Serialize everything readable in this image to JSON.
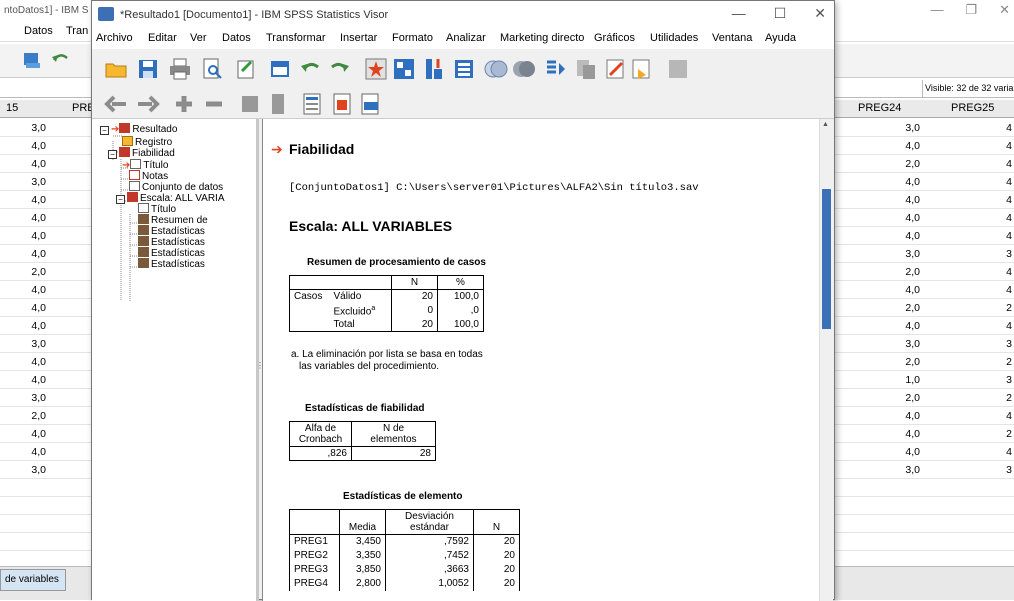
{
  "background_window": {
    "title": "ntoDatos1] - IBM S",
    "menu": [
      "Datos",
      "Tran"
    ],
    "visible_label": "Visible: 32 de 32 variable",
    "col_left_head": "15",
    "col_pre_head": "PRE",
    "col_preg24": "PREG24",
    "col_preg25": "PREG25",
    "left_values": [
      "3,0",
      "4,0",
      "4,0",
      "3,0",
      "4,0",
      "4,0",
      "4,0",
      "4,0",
      "2,0",
      "4,0",
      "4,0",
      "4,0",
      "3,0",
      "4,0",
      "4,0",
      "3,0",
      "2,0",
      "4,0",
      "4,0",
      "3,0"
    ],
    "preg24_values": [
      "3,0",
      "4,0",
      "2,0",
      "4,0",
      "4,0",
      "4,0",
      "4,0",
      "3,0",
      "2,0",
      "4,0",
      "2,0",
      "4,0",
      "3,0",
      "2,0",
      "1,0",
      "2,0",
      "4,0",
      "4,0",
      "4,0",
      "3,0"
    ],
    "preg25_values": [
      "4",
      "4",
      "4",
      "4",
      "4",
      "4",
      "4",
      "3",
      "4",
      "4",
      "2",
      "4",
      "3",
      "2",
      "3",
      "2",
      "4",
      "2",
      "4",
      "3"
    ],
    "tab_variable_view": "de variables"
  },
  "viewer": {
    "title": "*Resultado1 [Documento1] - IBM SPSS Statistics Visor",
    "menu": [
      "Archivo",
      "Editar",
      "Ver",
      "Datos",
      "Transformar",
      "Insertar",
      "Formato",
      "Analizar",
      "Marketing directo",
      "Gráficos",
      "Utilidades",
      "Ventana",
      "Ayuda"
    ],
    "outline": {
      "resultado": "Resultado",
      "registro": "Registro",
      "fiabilidad": "Fiabilidad",
      "titulo": "Título",
      "notas": "Notas",
      "conjunto": "Conjunto de datos",
      "escala": "Escala: ALL VARIA",
      "titulo2": "Título",
      "resumen": "Resumen de",
      "est1": "Estadísticas",
      "est2": "Estadísticas",
      "est3": "Estadísticas",
      "est4": "Estadísticas"
    },
    "content": {
      "heading": "Fiabilidad",
      "dataset_path": "[ConjuntoDatos1] C:\\Users\\server01\\Pictures\\ALFA2\\Sin título3.sav",
      "scale_title": "Escala: ALL VARIABLES",
      "summary": {
        "title": "Resumen de procesamiento de casos",
        "col_n": "N",
        "col_pct": "%",
        "casos": "Casos",
        "valido": "Válido",
        "valido_n": "20",
        "valido_pct": "100,0",
        "excluido": "Excluido",
        "excluido_sup": "a",
        "excluido_n": "0",
        "excluido_pct": ",0",
        "total": "Total",
        "total_n": "20",
        "total_pct": "100,0",
        "footnote_1": "a. La eliminación por lista se basa en todas",
        "footnote_2": "las variables del procedimiento."
      },
      "reliability": {
        "title": "Estadísticas de fiabilidad",
        "col_alpha_1": "Alfa de",
        "col_alpha_2": "Cronbach",
        "col_n_1": "N de",
        "col_n_2": "elementos",
        "alpha": ",826",
        "n_items": "28"
      },
      "items": {
        "title": "Estadísticas de elemento",
        "col_media": "Media",
        "col_sd_1": "Desviación",
        "col_sd_2": "estándar",
        "col_n": "N",
        "rows": [
          {
            "name": "PREG1",
            "media": "3,450",
            "sd": ",7592",
            "n": "20"
          },
          {
            "name": "PREG2",
            "media": "3,350",
            "sd": ",7452",
            "n": "20"
          },
          {
            "name": "PREG3",
            "media": "3,850",
            "sd": ",3663",
            "n": "20"
          },
          {
            "name": "PREG4",
            "media": "2,800",
            "sd": "1,0052",
            "n": "20"
          }
        ]
      }
    }
  }
}
